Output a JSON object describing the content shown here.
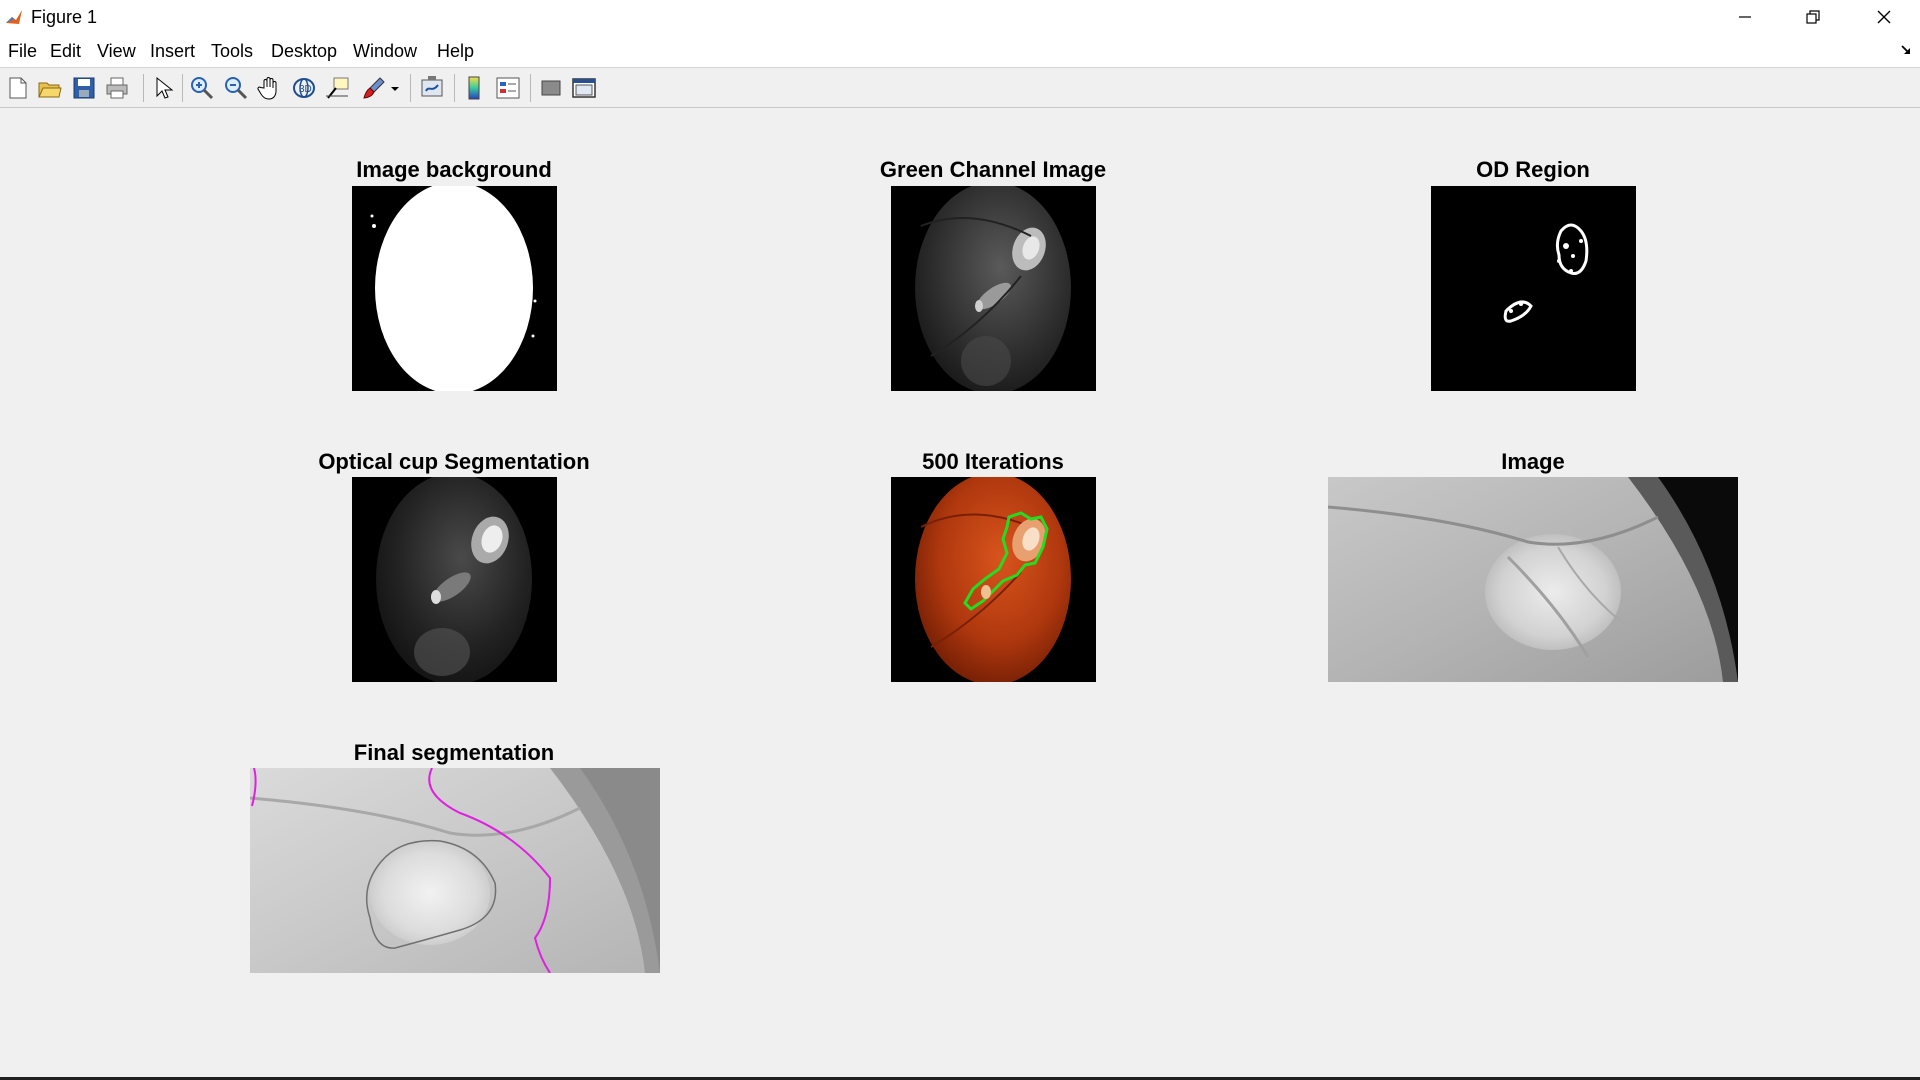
{
  "window": {
    "title": "Figure 1",
    "controls": {
      "minimize_icon": "minimize-icon",
      "maximize_icon": "restore-icon",
      "close_icon": "close-icon"
    }
  },
  "menu": {
    "items": [
      "File",
      "Edit",
      "View",
      "Insert",
      "Tools",
      "Desktop",
      "Window",
      "Help"
    ]
  },
  "toolbar": {
    "buttons": [
      "new-figure-icon",
      "open-file-icon",
      "save-icon",
      "print-icon",
      "select-arrow-icon",
      "zoom-in-icon",
      "zoom-out-icon",
      "pan-hand-icon",
      "rotate-3d-icon",
      "data-cursor-icon",
      "brush-icon",
      "link-plot-icon",
      "colorbar-icon",
      "legend-icon",
      "hide-plot-tools-icon",
      "show-plot-tools-icon"
    ]
  },
  "subplots": [
    {
      "title": "Image background",
      "image": "binary-ellipse-mask"
    },
    {
      "title": "Green Channel Image",
      "image": "grayscale-fundus"
    },
    {
      "title": "OD Region",
      "image": "binary-od-region"
    },
    {
      "title": "Optical cup Segmentation",
      "image": "grayscale-cup"
    },
    {
      "title": "500 Iterations",
      "image": "color-fundus-with-green-contour"
    },
    {
      "title": "Image",
      "image": "grayscale-od-crop"
    },
    {
      "title": "Final segmentation",
      "image": "grayscale-od-crop-with-contours"
    }
  ],
  "colors": {
    "titlebar_bg": "#ffffff",
    "figure_bg": "#f0f0f0",
    "contour_green": "#22dd22",
    "contour_magenta": "#e020e0",
    "contour_gray": "#707070"
  }
}
